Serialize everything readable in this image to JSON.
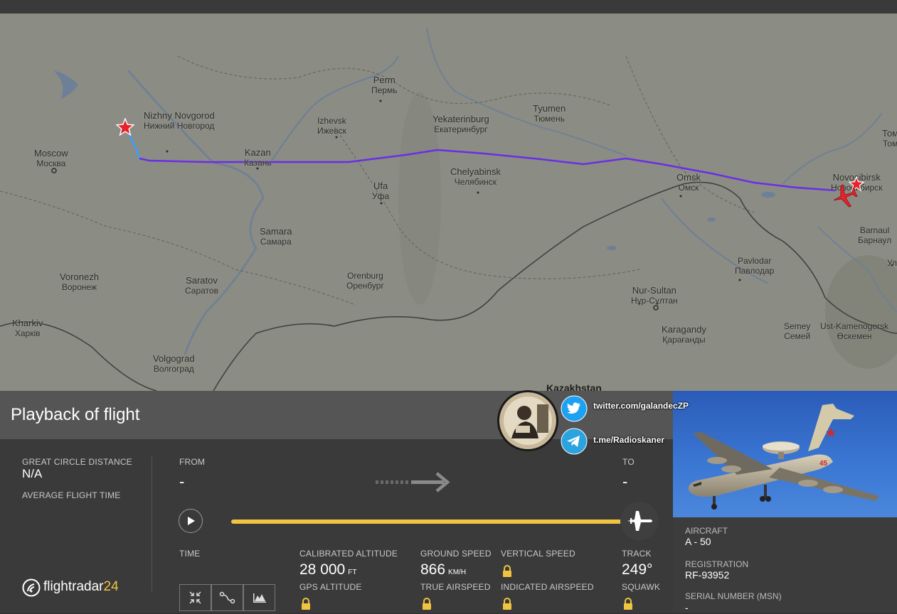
{
  "map": {
    "cities": [
      {
        "key": "moscow",
        "en": "Moscow",
        "ru": "Москва"
      },
      {
        "key": "nizhny",
        "en": "Nizhny Novgorod",
        "ru": "Нижний Новгород"
      },
      {
        "key": "kazan",
        "en": "Kazan",
        "ru": "Казань"
      },
      {
        "key": "izhevsk",
        "en": "Izhevsk",
        "ru": "Ижевск"
      },
      {
        "key": "perm",
        "en": "Perm",
        "ru": "Пермь"
      },
      {
        "key": "yekaterinburg",
        "en": "Yekaterinburg",
        "ru": "Екатеринбург"
      },
      {
        "key": "tyumen",
        "en": "Tyumen",
        "ru": "Тюмень"
      },
      {
        "key": "chelyabinsk",
        "en": "Chelyabinsk",
        "ru": "Челябинск"
      },
      {
        "key": "ufa",
        "en": "Ufa",
        "ru": "Уфа"
      },
      {
        "key": "omsk",
        "en": "Omsk",
        "ru": "Омск"
      },
      {
        "key": "novosibirsk",
        "en": "Novosibirsk",
        "ru": "Новосибирск"
      },
      {
        "key": "tomsk",
        "en": "Том",
        "ru": "Том"
      },
      {
        "key": "barnaul",
        "en": "Barnaul",
        "ru": "Барнаул"
      },
      {
        "key": "samara",
        "en": "Samara",
        "ru": "Самара"
      },
      {
        "key": "voronezh",
        "en": "Voronezh",
        "ru": "Воронеж"
      },
      {
        "key": "saratov",
        "en": "Saratov",
        "ru": "Саратов"
      },
      {
        "key": "orenburg",
        "en": "Orenburg",
        "ru": "Оренбург"
      },
      {
        "key": "pavlodar",
        "en": "Pavlodar",
        "ru": "Павлодар"
      },
      {
        "key": "nursultan",
        "en": "Nur-Sultan",
        "ru": "Нұр-Сұлтан"
      },
      {
        "key": "karagandy",
        "en": "Karagandy",
        "ru": "Қарағанды"
      },
      {
        "key": "kharkiv",
        "en": "Kharkiv",
        "ru": "Харків"
      },
      {
        "key": "volgograd",
        "en": "Volgograd",
        "ru": "Волгоград"
      },
      {
        "key": "semey",
        "en": "Semey",
        "ru": "Семей"
      },
      {
        "key": "ustkam",
        "en": "Ust-Kamenogorsk",
        "ru": "Өскемен"
      },
      {
        "key": "ul",
        "en": "Ул",
        "ru": ""
      }
    ],
    "country_label": "Kazakhstan",
    "route_color": "#6a2ee8",
    "route_start_color": "#3aa0ff",
    "origin_marker_color": "#e8212b",
    "aircraft_icon_color": "#e8212b"
  },
  "panel": {
    "title": "Playback of flight",
    "great_circle_label": "GREAT CIRCLE DISTANCE",
    "great_circle_value": "N/A",
    "avg_flight_time_label": "AVERAGE FLIGHT TIME",
    "from_label": "FROM",
    "from_value": "-",
    "to_label": "TO",
    "to_value": "-",
    "time_label": "TIME",
    "progress": 1.0,
    "calibrated_altitude_label": "CALIBRATED ALTITUDE",
    "calibrated_altitude_value": "28 000",
    "calibrated_altitude_unit": "FT",
    "gps_altitude_label": "GPS ALTITUDE",
    "ground_speed_label": "GROUND SPEED",
    "ground_speed_value": "866",
    "ground_speed_unit": "KM/H",
    "true_airspeed_label": "TRUE AIRSPEED",
    "vertical_speed_label": "VERTICAL SPEED",
    "indicated_airspeed_label": "INDICATED AIRSPEED",
    "track_label": "TRACK",
    "track_value": "249°",
    "squawk_label": "SQUAWK",
    "logo_text": "flightradar",
    "logo_suffix": "24",
    "accent_color": "#f0c341",
    "lock_color": "#f0c341"
  },
  "aircraft": {
    "aircraft_label": "AIRCRAFT",
    "aircraft_value": "A - 50",
    "registration_label": "REGISTRATION",
    "registration_value": "RF-93952",
    "serial_label": "SERIAL NUMBER (MSN)",
    "serial_value": "-",
    "photo_number": "45"
  },
  "overlay": {
    "twitter": "twitter.com/galandecZP",
    "telegram": "t.me/Radioskaner",
    "twitter_icon": "twitter-icon",
    "telegram_icon": "telegram-icon"
  }
}
